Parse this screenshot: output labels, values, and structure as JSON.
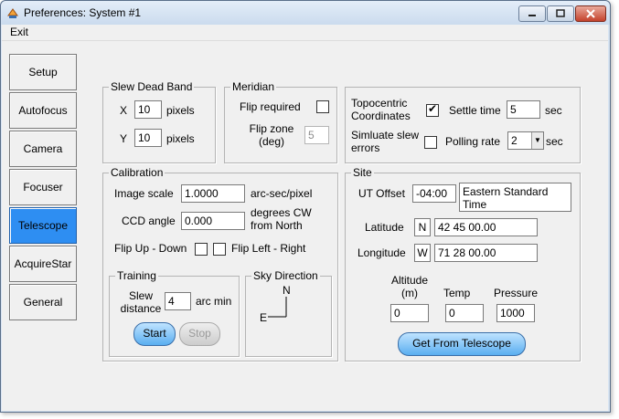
{
  "window": {
    "title": "Preferences: System #1"
  },
  "menu": {
    "exit": "Exit"
  },
  "nav": [
    {
      "label": "Setup"
    },
    {
      "label": "Autofocus"
    },
    {
      "label": "Camera"
    },
    {
      "label": "Focuser"
    },
    {
      "label": "Telescope",
      "active": true
    },
    {
      "label": "AcquireStar"
    },
    {
      "label": "General"
    }
  ],
  "slew_dead_band": {
    "legend": "Slew Dead Band",
    "x_label": "X",
    "x_value": "10",
    "y_label": "Y",
    "y_value": "10",
    "unit": "pixels"
  },
  "meridian": {
    "legend": "Meridian",
    "flip_required_label": "Flip required",
    "flip_required": false,
    "flip_zone_label": "Flip zone (deg)",
    "flip_zone_value": "5"
  },
  "misc": {
    "topocentric_label": "Topocentric Coordinates",
    "topocentric": true,
    "settle_time_label": "Settle time",
    "settle_time_value": "5",
    "settle_unit": "sec",
    "simulate_label": "Simluate slew errors",
    "simulate": false,
    "polling_label": "Polling rate",
    "polling_value": "2",
    "polling_unit": "sec"
  },
  "calibration": {
    "legend": "Calibration",
    "image_scale_label": "Image scale",
    "image_scale_value": "1.0000",
    "image_scale_unit": "arc-sec/pixel",
    "ccd_angle_label": "CCD angle",
    "ccd_angle_value": "0.000",
    "ccd_angle_unit": "degrees CW from North",
    "flip_ud_label": "Flip Up - Down",
    "flip_ud": false,
    "flip_lr_label": "Flip Left - Right",
    "flip_lr": false
  },
  "training": {
    "legend": "Training",
    "slew_distance_label": "Slew distance",
    "slew_distance_value": "4",
    "unit": "arc min",
    "start": "Start",
    "stop": "Stop"
  },
  "sky_direction": {
    "legend": "Sky Direction",
    "north": "N",
    "east": "E"
  },
  "site": {
    "legend": "Site",
    "ut_offset_label": "UT Offset",
    "ut_offset_value": "-04:00",
    "timezone": "Eastern Standard Time",
    "latitude_label": "Latitude",
    "lat_hemisphere": "N",
    "latitude_value": "42 45 00.00",
    "longitude_label": "Longitude",
    "lon_hemisphere": "W",
    "longitude_value": "71 28 00.00",
    "altitude_label": "Altitude (m)",
    "altitude_value": "0",
    "temp_label": "Temp",
    "temp_value": "0",
    "pressure_label": "Pressure",
    "pressure_value": "1000",
    "get_button": "Get From Telescope"
  }
}
